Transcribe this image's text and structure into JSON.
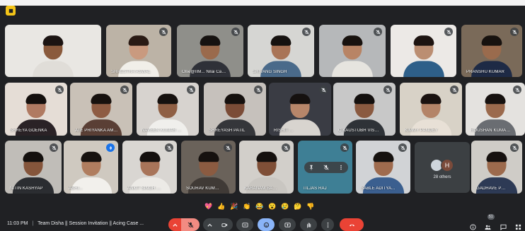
{
  "app": {
    "accent": "#f5c518",
    "end_call_color": "#ea4335"
  },
  "participants": [
    {
      "name": "",
      "bg": "#e9e7e3",
      "skin": "#8a5a3c",
      "hair": "#1b1412",
      "shirt": "#e0ddd8",
      "mic": "none"
    },
    {
      "name": "SHRESTHA ASWAL",
      "bg": "#bcb3a6",
      "skin": "#c99a7f",
      "hair": "#2a1a14",
      "shirt": "#f1efe9",
      "mic": "muted"
    },
    {
      "name": "Ollie@IIM... Nilai Campus",
      "bg": "#8f8f8a",
      "skin": "#9a6a4c",
      "hair": "#161210",
      "shirt": "#2f3138",
      "mic": "muted"
    },
    {
      "name": "SHIVANG SINGH",
      "bg": "#d6d6d3",
      "skin": "#a97456",
      "hair": "#16120f",
      "shirt": "#4a6a8a",
      "mic": "muted"
    },
    {
      "name": "",
      "bg": "#b6b8ba",
      "skin": "#b88465",
      "hair": "#18120f",
      "shirt": "#e6e4df",
      "mic": "muted"
    },
    {
      "name": "",
      "bg": "#ece9e6",
      "skin": "#bb8e72",
      "hair": "#1d1411",
      "shirt": "#2e5f89",
      "mic": "muted"
    },
    {
      "name": "PRANSHU KUMAR",
      "bg": "#7a6a59",
      "skin": "#9a6b4d",
      "hair": "#17120f",
      "shirt": "#1e2a45",
      "mic": "muted"
    },
    {
      "name": "SHREYA GOENKA",
      "bg": "#e5ddd6",
      "skin": "#b07a62",
      "hair": "#140f0d",
      "shirt": "#2a2226",
      "mic": "muted"
    },
    {
      "name": "ATE PRIYANKA AMARDE...",
      "bg": "#c9c1b7",
      "skin": "#8e5c43",
      "hair": "#17110e",
      "shirt": "#5a3f35",
      "mic": "muted"
    },
    {
      "name": "NAVEEN KUMAR GANTA",
      "bg": "#d7d3cf",
      "skin": "#8f5f44",
      "hair": "#15110f",
      "shirt": "#f0efec",
      "mic": "muted"
    },
    {
      "name": "SHREYASH PATIL",
      "bg": "#c6c1bc",
      "skin": "#7b4c37",
      "hair": "#15100e",
      "shirt": "#35363a",
      "mic": "muted"
    },
    {
      "name": "RISHIT ...",
      "bg": "#3a3c44",
      "skin": "#b7866a",
      "hair": "#151110",
      "shirt": "#d8d4cf",
      "mic": "muted"
    },
    {
      "name": "C KAUSTUBH VISESH G...",
      "bg": "#c8c8c8",
      "skin": "#8a5a40",
      "hair": "#14100e",
      "shirt": "#2e3237",
      "mic": "muted"
    },
    {
      "name": "KIMMY PANDEY",
      "bg": "#d8d2c7",
      "skin": "#b48468",
      "hair": "#1a1210",
      "shirt": "#e8e0d6",
      "mic": "muted"
    },
    {
      "name": "ROUSHAN KUMAR JHA",
      "bg": "#e4e2df",
      "skin": "#9b6a4d",
      "hair": "#16110f",
      "shirt": "#6a6d72",
      "mic": "muted"
    },
    {
      "name": "NITIN KASHYAP",
      "bg": "#c0bdb8",
      "skin": "#85553b",
      "hair": "#14100e",
      "shirt": "#2b2d31",
      "mic": "muted"
    },
    {
      "name": "ABHI...",
      "bg": "#cfc9c0",
      "skin": "#b07d5f",
      "hair": "#17120f",
      "shirt": "#f2f0ec",
      "mic": "active"
    },
    {
      "name": "ANKIT SINGH GODARA",
      "bg": "#d9d6d2",
      "skin": "#a87459",
      "hair": "#14100e",
      "shirt": "#eceae6",
      "mic": "muted"
    },
    {
      "name": "SOURAV KUMAR RA...",
      "bg": "#6a625a",
      "skin": "#8b5b41",
      "hair": "#16110f",
      "shirt": "#403a36",
      "mic": "muted"
    },
    {
      "name": "KARANAM BABU SAI...",
      "bg": "#d2cfca",
      "skin": "#7f4f37",
      "hair": "#15100e",
      "shirt": "#c9c6c1",
      "mic": "muted"
    },
    {
      "name": "TILJAS RAJ",
      "bg": "#3e7f95",
      "skin": "#3e7f95",
      "hair": "#3e7f95",
      "shirt": "#3e7f95",
      "mic": "muted"
    },
    {
      "name": "SABLE ADITYA ARUN",
      "bg": "#d1d3d6",
      "skin": "#9f6b4e",
      "hair": "#15110f",
      "shirt": "#3b5f8f",
      "mic": "muted"
    },
    {
      "name": "GADHAVE PRU...",
      "bg": "#cfccc7",
      "skin": "#9c6a4d",
      "hair": "#16110f",
      "shirt": "#2d3a55",
      "mic": "muted"
    }
  ],
  "others": {
    "label": "28 others",
    "initial": "H"
  },
  "reactions": [
    "💖",
    "👍",
    "🎉",
    "👏",
    "😂",
    "😮",
    "😢",
    "🤔",
    "👎"
  ],
  "meeting": {
    "time": "11:03 PM",
    "title": "Team Disha || Session Invitation || Acing Case ..."
  },
  "participant_count": "51"
}
